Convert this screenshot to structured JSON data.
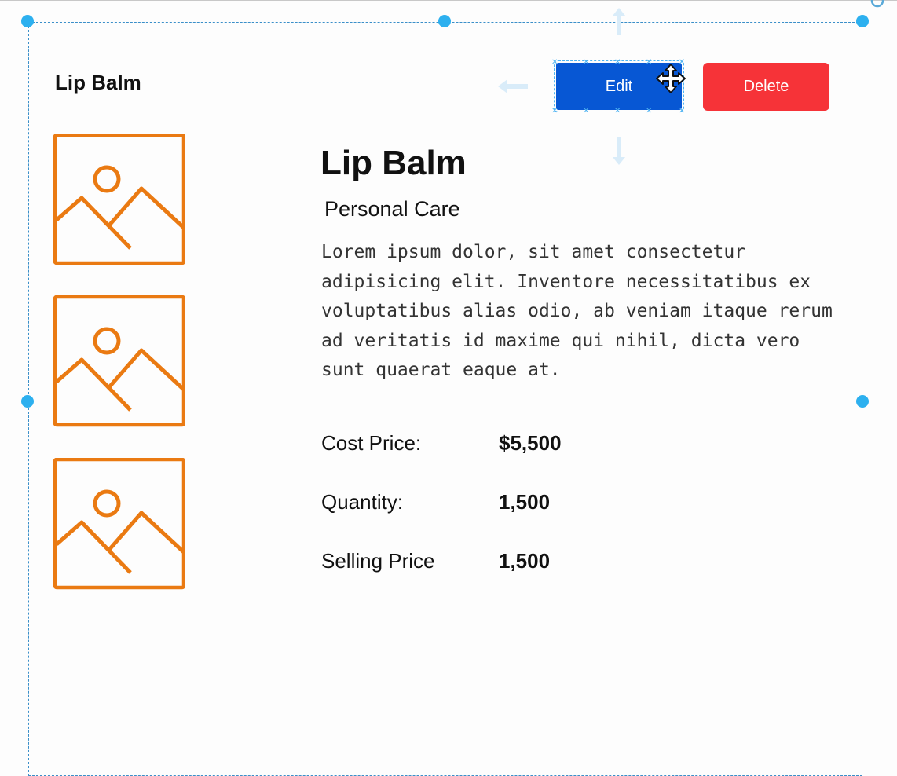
{
  "card": {
    "header_title": "Lip Balm",
    "edit_label": "Edit",
    "delete_label": "Delete"
  },
  "product": {
    "name": "Lip Balm",
    "category": "Personal Care",
    "description": "Lorem ipsum dolor, sit amet consectetur adipisicing elit. Inventore necessitatibus ex voluptatibus alias odio, ab veniam itaque rerum ad veritatis id maxime qui nihil, dicta vero sunt quaerat eaque at.",
    "details": [
      {
        "label": "Cost Price:",
        "value": "$5,500"
      },
      {
        "label": "Quantity:",
        "value": "1,500"
      },
      {
        "label": "Selling Price",
        "value": "1,500"
      }
    ]
  },
  "thumbnails": [
    {
      "icon": "image-placeholder-icon"
    },
    {
      "icon": "image-placeholder-icon"
    },
    {
      "icon": "image-placeholder-icon"
    }
  ],
  "colors": {
    "edit_button": "#0757d4",
    "delete_button": "#f63338",
    "thumbnail_icon": "#ea7a12",
    "selection": "#2db0ef"
  }
}
